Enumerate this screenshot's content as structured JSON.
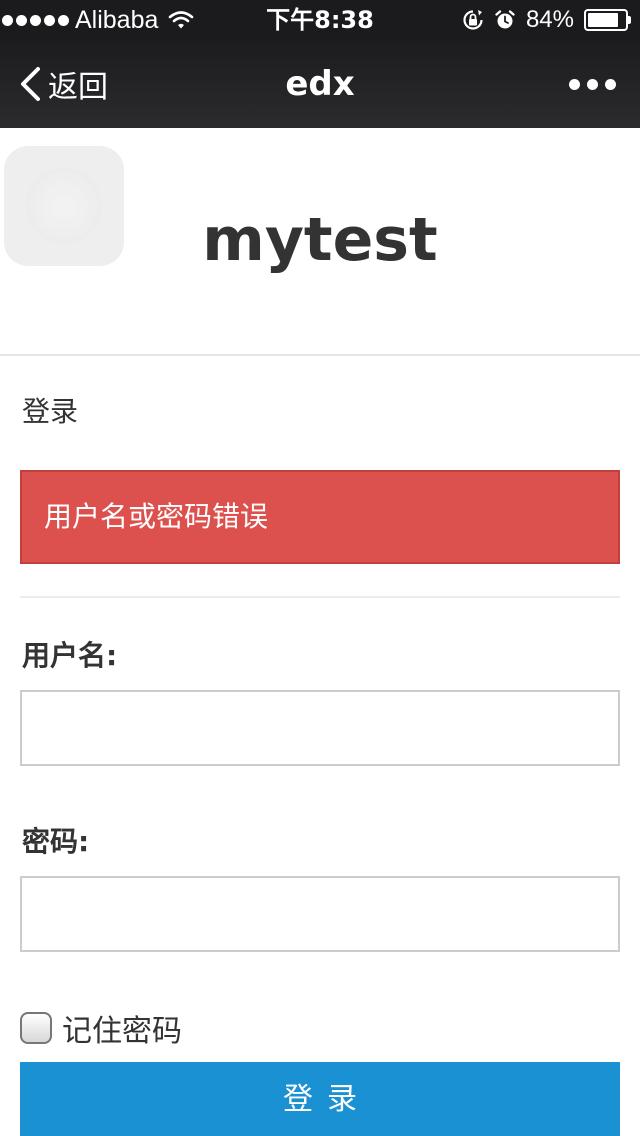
{
  "status_bar": {
    "carrier": "Alibaba",
    "time": "下午8:38",
    "battery_percent_label": "84%",
    "battery_level": 0.84,
    "signal_bars": 5,
    "icons": [
      "wifi-icon",
      "orientation-lock-icon",
      "alarm-icon",
      "battery-icon"
    ]
  },
  "nav_bar": {
    "back_label": "返回",
    "title": "edx",
    "more_icon": "more-dots-icon"
  },
  "header": {
    "site_title": "mytest",
    "logo_icon": "app-logo-placeholder"
  },
  "login_form": {
    "heading": "登录",
    "error_message": "用户名或密码错误",
    "username_label": "用户名:",
    "username_value": "",
    "password_label": "密码:",
    "password_value": "",
    "remember_label": "记住密码",
    "remember_checked": false,
    "submit_label": "登录"
  },
  "colors": {
    "error_background": "#dc514d",
    "primary_button": "#1a91d3",
    "nav_background": "#1c1c1e"
  }
}
